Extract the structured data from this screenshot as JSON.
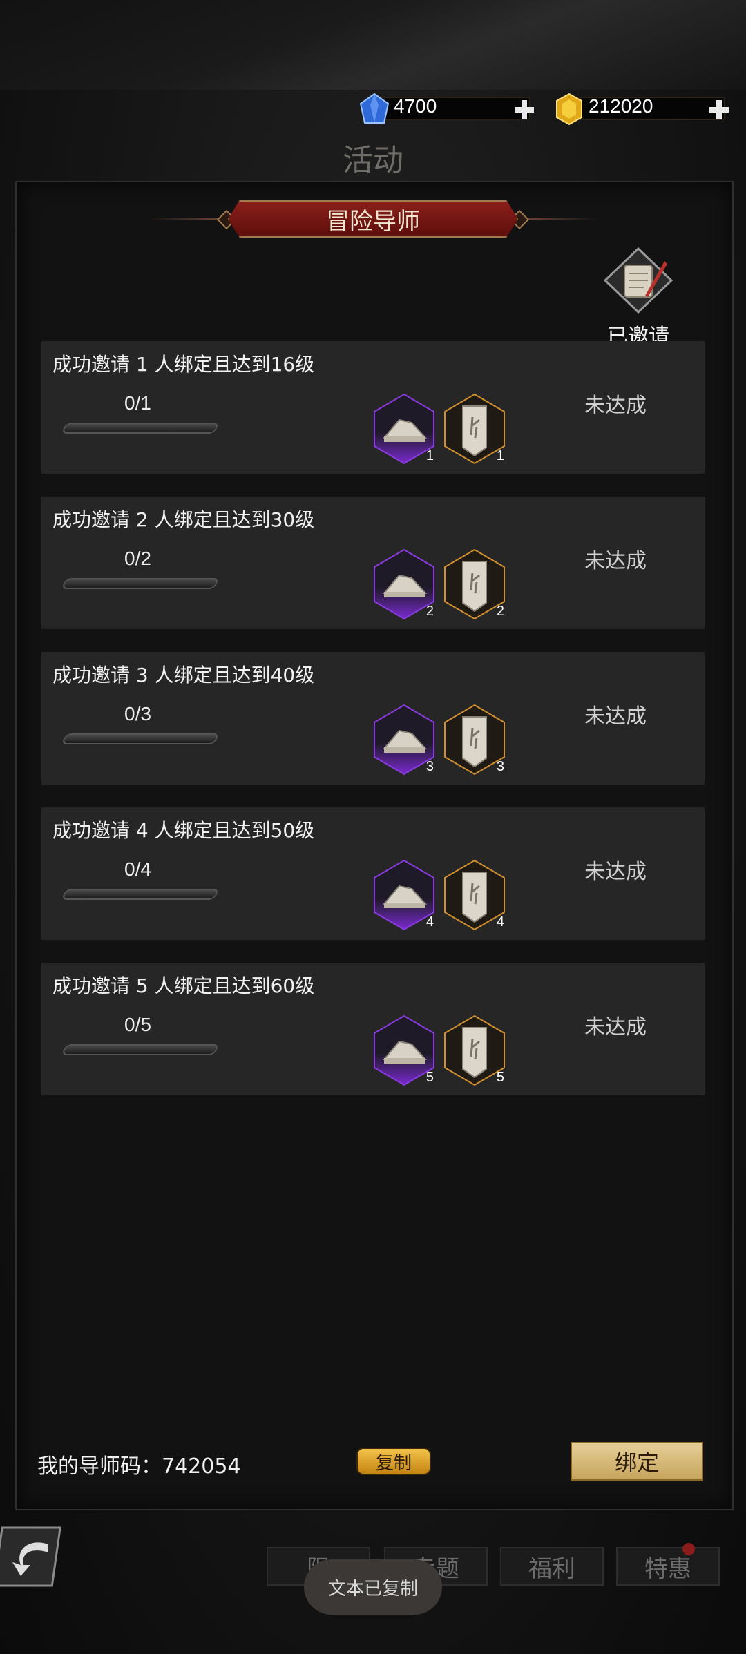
{
  "currency": {
    "diamond": {
      "amount": "4700",
      "icon": "blue-diamond-icon"
    },
    "gold": {
      "amount": "212020",
      "icon": "gold-gem-icon"
    }
  },
  "page_title": "活动",
  "panel": {
    "banner_title": "冒险导师",
    "invited_label": "已邀请"
  },
  "tasks": [
    {
      "title": "成功邀请 1 人绑定且达到16级",
      "progress": "0/1",
      "progress_fraction": 0,
      "reward1_count": "1",
      "reward2_count": "1",
      "status": "未达成"
    },
    {
      "title": "成功邀请 2 人绑定且达到30级",
      "progress": "0/2",
      "progress_fraction": 0,
      "reward1_count": "2",
      "reward2_count": "2",
      "status": "未达成"
    },
    {
      "title": "成功邀请 3 人绑定且达到40级",
      "progress": "0/3",
      "progress_fraction": 0,
      "reward1_count": "3",
      "reward2_count": "3",
      "status": "未达成"
    },
    {
      "title": "成功邀请 4 人绑定且达到50级",
      "progress": "0/4",
      "progress_fraction": 0,
      "reward1_count": "4",
      "reward2_count": "4",
      "status": "未达成"
    },
    {
      "title": "成功邀请 5 人绑定且达到60级",
      "progress": "0/5",
      "progress_fraction": 0,
      "reward1_count": "5",
      "reward2_count": "5",
      "status": "未达成"
    }
  ],
  "footer": {
    "mentor_code_label": "我的导师码：742054",
    "copy_label": "复制",
    "bind_label": "绑定"
  },
  "nav": {
    "tab1": "限",
    "tab2": "专题",
    "tab3": "福利",
    "tab4": "特惠"
  },
  "toast": "文本已复制",
  "colors": {
    "banner": "#8a1f1a",
    "accent_gold": "#d6b35a",
    "reward_purple": "#7a2ad0",
    "reward_orange": "#d09030"
  }
}
